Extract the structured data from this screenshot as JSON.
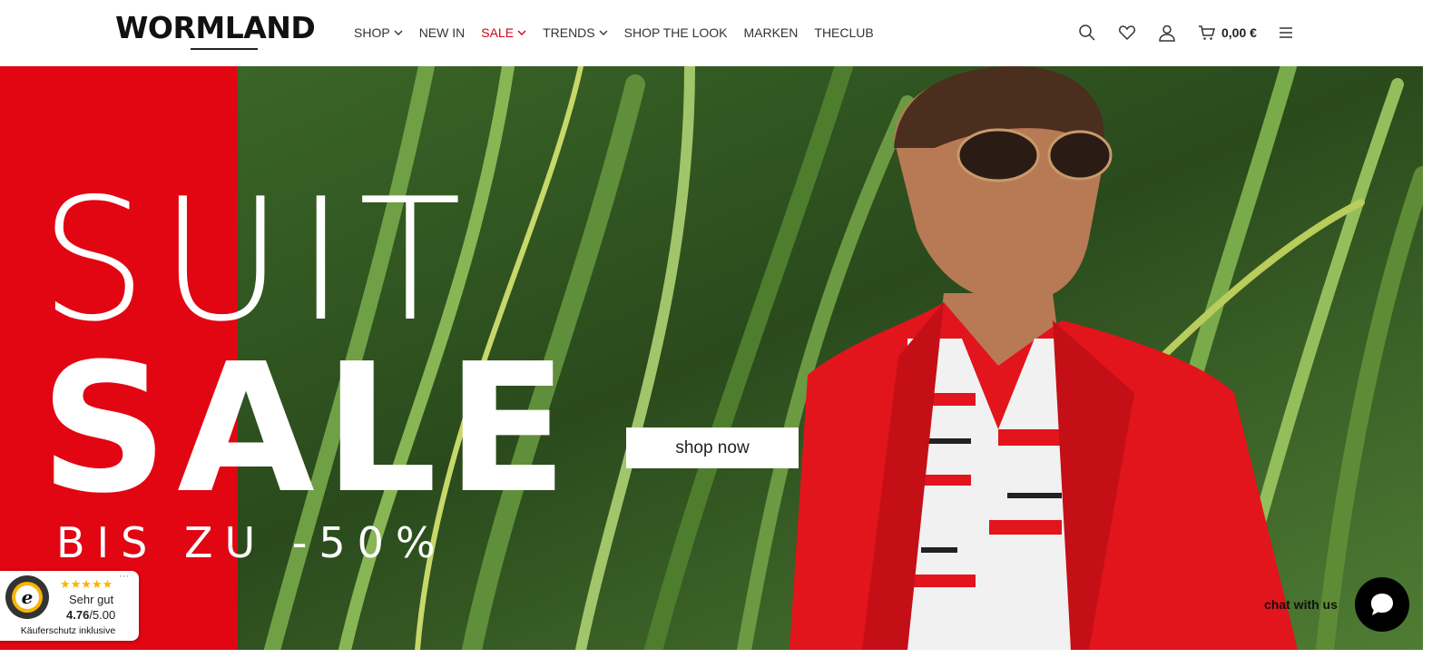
{
  "header": {
    "logo": "WORMLAND",
    "nav": [
      {
        "label": "SHOP",
        "has_dropdown": true,
        "color": "#333333"
      },
      {
        "label": "NEW IN",
        "has_dropdown": false,
        "color": "#333333"
      },
      {
        "label": "SALE",
        "has_dropdown": true,
        "color": "#d0021b"
      },
      {
        "label": "TRENDS",
        "has_dropdown": true,
        "color": "#333333"
      },
      {
        "label": "SHOP THE LOOK",
        "has_dropdown": false,
        "color": "#333333"
      },
      {
        "label": "MARKEN",
        "has_dropdown": false,
        "color": "#333333"
      },
      {
        "label": "THECLUB",
        "has_dropdown": false,
        "color": "#333333"
      }
    ],
    "icons": [
      "search-icon",
      "heart-icon",
      "user-icon",
      "cart-icon"
    ],
    "cart_total": "0,00 €",
    "menu_icon": "hamburger-menu-icon"
  },
  "hero": {
    "line1": "SUIT",
    "line2": "SALE",
    "line3": "BIS ZU -50%",
    "cta": "shop now",
    "accent_color": "#e10612"
  },
  "trusted_shops": {
    "stars": "★★★★★",
    "rating_label": "Sehr gut",
    "score": "4.76",
    "score_max": "/5.00",
    "footer": "Käuferschutz inklusive",
    "more": "···"
  },
  "chat": {
    "label": "chat with us"
  }
}
